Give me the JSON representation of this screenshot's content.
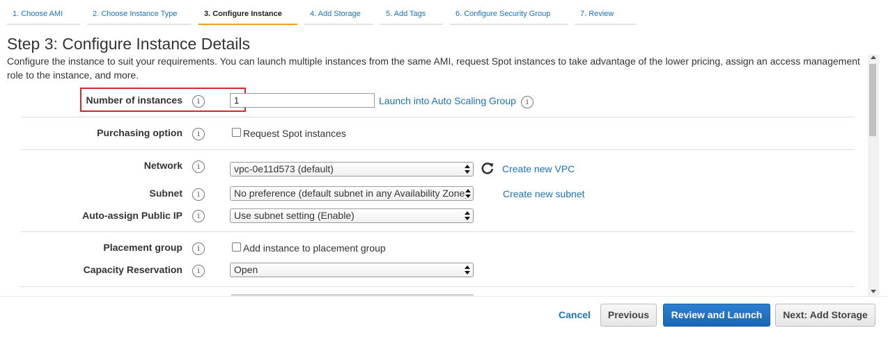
{
  "tabs": [
    {
      "label": "1. Choose AMI",
      "active": false
    },
    {
      "label": "2. Choose Instance Type",
      "active": false
    },
    {
      "label": "3. Configure Instance",
      "active": true
    },
    {
      "label": "4. Add Storage",
      "active": false
    },
    {
      "label": "5. Add Tags",
      "active": false
    },
    {
      "label": "6. Configure Security Group",
      "active": false
    },
    {
      "label": "7. Review",
      "active": false
    }
  ],
  "page": {
    "title": "Step 3: Configure Instance Details",
    "description": "Configure the instance to suit your requirements. You can launch multiple instances from the same AMI, request Spot instances to take advantage of the lower pricing, assign an access management role to the instance, and more."
  },
  "form": {
    "number_of_instances": {
      "label": "Number of instances",
      "value": "1",
      "link": "Launch into Auto Scaling Group"
    },
    "purchasing_option": {
      "label": "Purchasing option",
      "checkbox_label": "Request Spot instances",
      "checked": false
    },
    "network": {
      "label": "Network",
      "selected": "vpc-0e11d573 (default)",
      "link": "Create new VPC"
    },
    "subnet": {
      "label": "Subnet",
      "selected": "No preference (default subnet in any Availability Zone)",
      "link": "Create new subnet"
    },
    "auto_assign_public_ip": {
      "label": "Auto-assign Public IP",
      "selected": "Use subnet setting (Enable)"
    },
    "placement_group": {
      "label": "Placement group",
      "checkbox_label": "Add instance to placement group",
      "checked": false
    },
    "capacity_reservation": {
      "label": "Capacity Reservation",
      "selected": "Open"
    },
    "info_glyph": "i"
  },
  "footer": {
    "cancel": "Cancel",
    "previous": "Previous",
    "review_and_launch": "Review and Launch",
    "next": "Next: Add Storage"
  },
  "colors": {
    "link": "#1a73b8",
    "active_tab_underline": "#f39c1f",
    "highlight_border": "#d9262e",
    "primary_button": "#1b66b6"
  }
}
